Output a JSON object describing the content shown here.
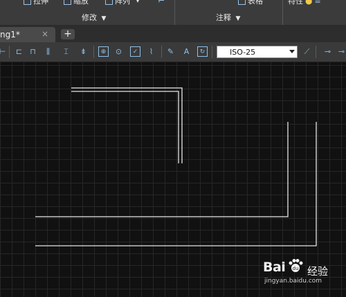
{
  "ribbon": {
    "stretch_label": "拉伸",
    "scale_label": "缩放",
    "array_label": "阵列",
    "table_label": "表格",
    "properties_label": "特性",
    "modify_panel": "修改",
    "annotate_panel": "注释"
  },
  "tabs": {
    "document_tab": "ng1*",
    "close_glyph": "×",
    "new_tab_glyph": "+"
  },
  "toolbar": {
    "dimension_style": "ISO-25"
  },
  "icons": {
    "ribbon": [
      "stretch-icon",
      "scale-icon",
      "array-icon",
      "table-icon",
      "lightbulb-icon"
    ],
    "toolbar": [
      "linear-dim-icon",
      "aligned-dim-icon",
      "baseline-dim-icon",
      "continue-dim-icon",
      "ordinate-dim-icon",
      "tolerance-icon",
      "center-mark-icon",
      "inspect-icon",
      "jogged-linear-icon",
      "dim-edit-icon",
      "dim-text-edit-icon",
      "dim-update-icon",
      "dim-style-icon",
      "leader-icon"
    ]
  },
  "watermark": {
    "brand": "Bai",
    "brand_suffix": "经验",
    "url": "jingyan.baidu.com"
  },
  "colors": {
    "ribbon_bg": "#3b3b3b",
    "canvas_bg": "#111111",
    "grid": "#262626",
    "line": "#e6e6e6",
    "icon_accent": "#8fc0e8"
  }
}
